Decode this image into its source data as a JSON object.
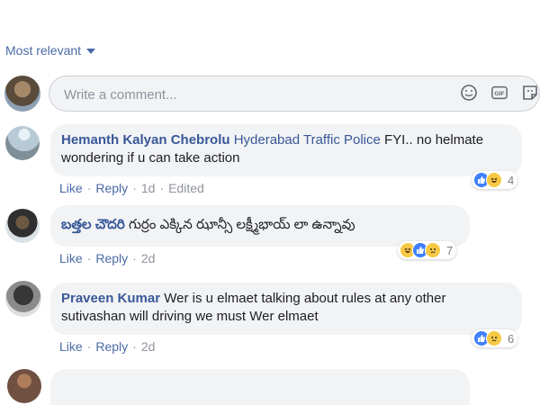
{
  "sort": {
    "label": "Most relevant"
  },
  "composer": {
    "placeholder": "Write a comment..."
  },
  "comments": [
    {
      "author": "Hemanth Kalyan Chebrolu",
      "mention": "Hyderabad Traffic Police",
      "text": "FYI.. no helmate wondering if u can take action",
      "reaction_count": "4",
      "actions": {
        "like": "Like",
        "reply": "Reply",
        "time": "1d",
        "edited": "Edited"
      }
    },
    {
      "author": "బత్తల చౌదరి",
      "text": "గుర్రం ఎక్కిన ఝాన్సీ లక్ష్మీభాయ్ లా ఉన్నావు",
      "reaction_count": "7",
      "actions": {
        "like": "Like",
        "reply": "Reply",
        "time": "2d"
      }
    },
    {
      "author": "Praveen Kumar",
      "text": "Wer is u elmaet talking about rules at any other sutivashan will driving we must Wer elmaet",
      "reaction_count": "6",
      "actions": {
        "like": "Like",
        "reply": "Reply",
        "time": "2d"
      }
    }
  ],
  "colors": {
    "link": "#4b6aa6",
    "author": "#385898",
    "bubble": "#f2f3f5",
    "meta": "#90949c"
  },
  "icons": [
    "caret-down-icon",
    "emoji-icon",
    "gif-icon",
    "sticker-icon",
    "like-reaction-icon",
    "haha-reaction-icon",
    "sad-reaction-icon"
  ]
}
